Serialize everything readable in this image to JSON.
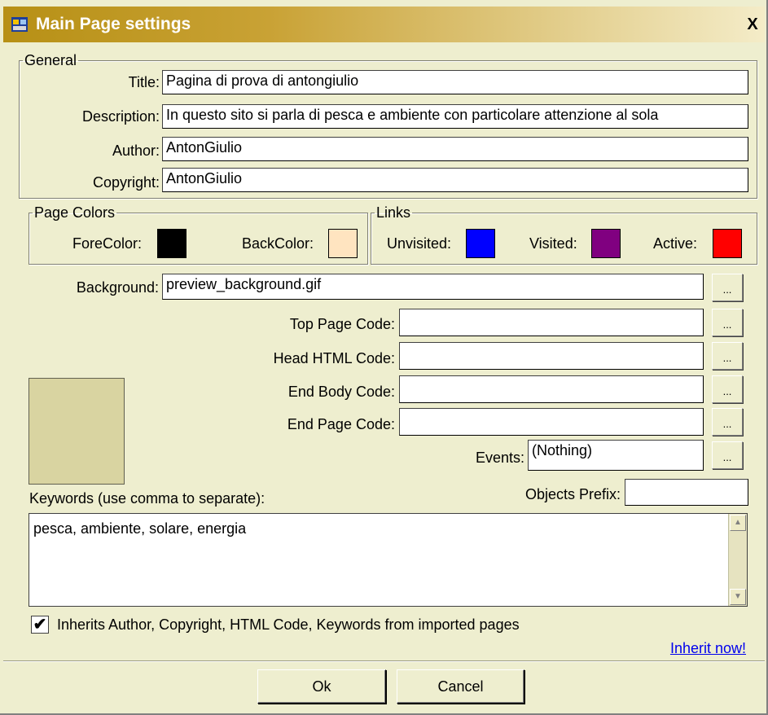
{
  "window": {
    "title": "Main Page settings",
    "close_label": "X"
  },
  "general": {
    "legend": "General",
    "title_label": "Title:",
    "title_value": "Pagina di prova di antongiulio",
    "description_label": "Description:",
    "description_value": "In questo sito si parla di pesca e ambiente con particolare attenzione al sola",
    "author_label": "Author:",
    "author_value": "AntonGiulio",
    "copyright_label": "Copyright:",
    "copyright_value": "AntonGiulio"
  },
  "page_colors": {
    "legend": "Page Colors",
    "forecolor_label": "ForeColor:",
    "forecolor": "#000000",
    "backcolor_label": "BackColor:",
    "backcolor": "#FFE4C0"
  },
  "links": {
    "legend": "Links",
    "unvisited_label": "Unvisited:",
    "unvisited": "#0000FF",
    "visited_label": "Visited:",
    "visited": "#800080",
    "active_label": "Active:",
    "active": "#FF0000"
  },
  "background": {
    "label": "Background:",
    "value": "preview_background.gif",
    "browse_label": "..."
  },
  "code": {
    "top_label": "Top Page Code:",
    "top_value": "",
    "head_label": "Head HTML Code:",
    "head_value": "",
    "endbody_label": "End Body Code:",
    "endbody_value": "",
    "endpage_label": "End Page Code:",
    "endpage_value": "",
    "events_label": "Events:",
    "events_value": "(Nothing)",
    "browse_label": "..."
  },
  "preview_color": "#D9D4A1",
  "keywords": {
    "label": "Keywords (use comma to separate):",
    "value": "pesca, ambiente, solare, energia"
  },
  "objects_prefix": {
    "label": "Objects Prefix:",
    "value": ""
  },
  "inherit": {
    "label": "Inherits Author, Copyright, HTML Code, Keywords from imported pages",
    "checked": true,
    "link": "Inherit now!"
  },
  "buttons": {
    "ok": "Ok",
    "cancel": "Cancel"
  }
}
